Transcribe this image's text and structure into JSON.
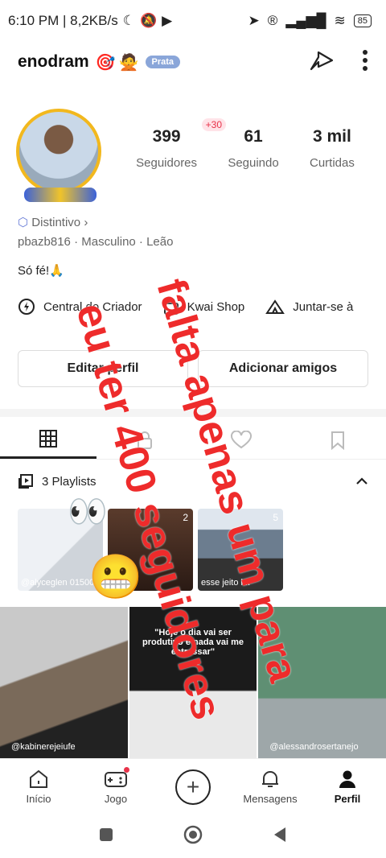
{
  "status_bar": {
    "time_speed": "6:10 PM | 8,2KB/s",
    "battery": "85"
  },
  "profile": {
    "username": "enodram",
    "tier_badge": "Prata",
    "stats": [
      {
        "value": "399",
        "label": "Seguidores",
        "delta": "+30"
      },
      {
        "value": "61",
        "label": "Seguindo"
      },
      {
        "value": "3 mil",
        "label": "Curtidas"
      }
    ],
    "distintivo": "Distintivo",
    "meta": "pbazb816 · Masculino · Leão",
    "bio": "Só fé!🙏"
  },
  "links": [
    {
      "label": "Central do Criador",
      "icon": "lightning-icon"
    },
    {
      "label": "Kwai Shop",
      "icon": "bag-icon"
    },
    {
      "label": "Juntar-se à",
      "icon": "tent-icon"
    }
  ],
  "buttons": {
    "edit": "Editar perfil",
    "add": "Adicionar amigos"
  },
  "playlists": {
    "label": "3 Playlists",
    "cards": [
      {
        "caption": "@alyceglen 01500015403",
        "count": ""
      },
      {
        "caption": "ência",
        "count": "2"
      },
      {
        "caption": "esse jeito kk",
        "count": "5"
      }
    ]
  },
  "grid": [
    {
      "text": "",
      "handle": "@kabinerejeiufe"
    },
    {
      "text": "\"Hoje o dia vai ser produtivo e nada vai me estressar\"",
      "handle": ""
    },
    {
      "text": "",
      "handle": "@alessandrosertanejo"
    }
  ],
  "overlay": {
    "line1": "falta apenas um para",
    "line2": "eu ter 400 seguidores"
  },
  "nav": [
    {
      "label": "Início"
    },
    {
      "label": "Jogo"
    },
    {
      "label": ""
    },
    {
      "label": "Mensagens"
    },
    {
      "label": "Perfil"
    }
  ]
}
